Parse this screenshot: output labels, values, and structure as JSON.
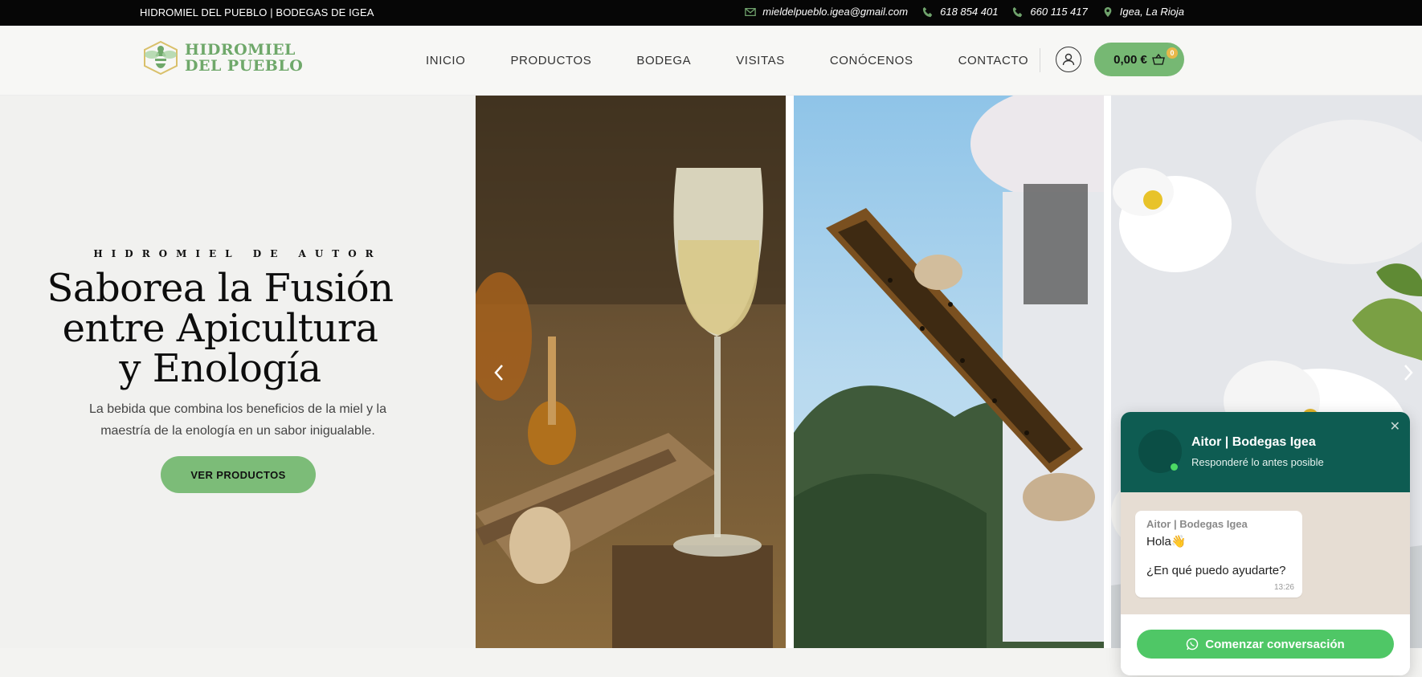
{
  "topbar": {
    "brandline": "HIDROMIEL DEL PUEBLO | BODEGAS DE IGEA",
    "email": "mieldelpueblo.igea@gmail.com",
    "phone1": "618 854 401",
    "phone2": "660 115 417",
    "location": "Igea, La Rioja"
  },
  "header": {
    "logo_line1": "HIDROMIEL",
    "logo_line2": "DEL PUEBLO",
    "nav": [
      "INICIO",
      "PRODUCTOS",
      "BODEGA",
      "VISITAS",
      "CONÓCENOS",
      "CONTACTO"
    ],
    "cart_total": "0,00 €",
    "cart_count": "0"
  },
  "hero": {
    "eyebrow": "HIDROMIEL DE AUTOR",
    "title_line1": "Saborea la Fusión",
    "title_line2": "entre Apicultura",
    "title_line3": "y Enología",
    "subtitle_line1": "La bebida que combina los beneficios de la miel y la",
    "subtitle_line2": "maestría de la enología en un sabor inigualable.",
    "cta": "VER PRODUCTOS"
  },
  "carousel": {
    "slides": [
      "wine-glass-honey-photo",
      "beekeeper-honeycomb-photo",
      "white-blossom-photo"
    ]
  },
  "chat": {
    "agent_name": "Aitor | Bodegas Igea",
    "agent_status": "Responderé lo antes posible",
    "message_sender": "Aitor | Bodegas Igea",
    "message_hola": "Hola👋",
    "message_question": "¿En qué puedo ayudarte?",
    "message_time": "13:26",
    "cta": "Comenzar conversación"
  },
  "colors": {
    "brand_green": "#76b873",
    "chat_header": "#0e5c52",
    "whatsapp_green": "#4fc766"
  }
}
